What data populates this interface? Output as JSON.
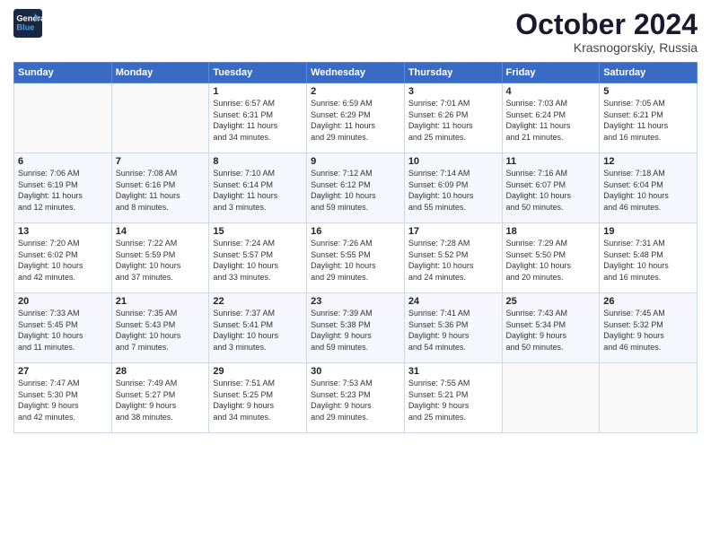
{
  "header": {
    "logo_line1": "General",
    "logo_line2": "Blue",
    "month": "October 2024",
    "location": "Krasnogorskiy, Russia"
  },
  "days_of_week": [
    "Sunday",
    "Monday",
    "Tuesday",
    "Wednesday",
    "Thursday",
    "Friday",
    "Saturday"
  ],
  "weeks": [
    [
      {
        "day": "",
        "info": ""
      },
      {
        "day": "",
        "info": ""
      },
      {
        "day": "1",
        "info": "Sunrise: 6:57 AM\nSunset: 6:31 PM\nDaylight: 11 hours\nand 34 minutes."
      },
      {
        "day": "2",
        "info": "Sunrise: 6:59 AM\nSunset: 6:29 PM\nDaylight: 11 hours\nand 29 minutes."
      },
      {
        "day": "3",
        "info": "Sunrise: 7:01 AM\nSunset: 6:26 PM\nDaylight: 11 hours\nand 25 minutes."
      },
      {
        "day": "4",
        "info": "Sunrise: 7:03 AM\nSunset: 6:24 PM\nDaylight: 11 hours\nand 21 minutes."
      },
      {
        "day": "5",
        "info": "Sunrise: 7:05 AM\nSunset: 6:21 PM\nDaylight: 11 hours\nand 16 minutes."
      }
    ],
    [
      {
        "day": "6",
        "info": "Sunrise: 7:06 AM\nSunset: 6:19 PM\nDaylight: 11 hours\nand 12 minutes."
      },
      {
        "day": "7",
        "info": "Sunrise: 7:08 AM\nSunset: 6:16 PM\nDaylight: 11 hours\nand 8 minutes."
      },
      {
        "day": "8",
        "info": "Sunrise: 7:10 AM\nSunset: 6:14 PM\nDaylight: 11 hours\nand 3 minutes."
      },
      {
        "day": "9",
        "info": "Sunrise: 7:12 AM\nSunset: 6:12 PM\nDaylight: 10 hours\nand 59 minutes."
      },
      {
        "day": "10",
        "info": "Sunrise: 7:14 AM\nSunset: 6:09 PM\nDaylight: 10 hours\nand 55 minutes."
      },
      {
        "day": "11",
        "info": "Sunrise: 7:16 AM\nSunset: 6:07 PM\nDaylight: 10 hours\nand 50 minutes."
      },
      {
        "day": "12",
        "info": "Sunrise: 7:18 AM\nSunset: 6:04 PM\nDaylight: 10 hours\nand 46 minutes."
      }
    ],
    [
      {
        "day": "13",
        "info": "Sunrise: 7:20 AM\nSunset: 6:02 PM\nDaylight: 10 hours\nand 42 minutes."
      },
      {
        "day": "14",
        "info": "Sunrise: 7:22 AM\nSunset: 5:59 PM\nDaylight: 10 hours\nand 37 minutes."
      },
      {
        "day": "15",
        "info": "Sunrise: 7:24 AM\nSunset: 5:57 PM\nDaylight: 10 hours\nand 33 minutes."
      },
      {
        "day": "16",
        "info": "Sunrise: 7:26 AM\nSunset: 5:55 PM\nDaylight: 10 hours\nand 29 minutes."
      },
      {
        "day": "17",
        "info": "Sunrise: 7:28 AM\nSunset: 5:52 PM\nDaylight: 10 hours\nand 24 minutes."
      },
      {
        "day": "18",
        "info": "Sunrise: 7:29 AM\nSunset: 5:50 PM\nDaylight: 10 hours\nand 20 minutes."
      },
      {
        "day": "19",
        "info": "Sunrise: 7:31 AM\nSunset: 5:48 PM\nDaylight: 10 hours\nand 16 minutes."
      }
    ],
    [
      {
        "day": "20",
        "info": "Sunrise: 7:33 AM\nSunset: 5:45 PM\nDaylight: 10 hours\nand 11 minutes."
      },
      {
        "day": "21",
        "info": "Sunrise: 7:35 AM\nSunset: 5:43 PM\nDaylight: 10 hours\nand 7 minutes."
      },
      {
        "day": "22",
        "info": "Sunrise: 7:37 AM\nSunset: 5:41 PM\nDaylight: 10 hours\nand 3 minutes."
      },
      {
        "day": "23",
        "info": "Sunrise: 7:39 AM\nSunset: 5:38 PM\nDaylight: 9 hours\nand 59 minutes."
      },
      {
        "day": "24",
        "info": "Sunrise: 7:41 AM\nSunset: 5:36 PM\nDaylight: 9 hours\nand 54 minutes."
      },
      {
        "day": "25",
        "info": "Sunrise: 7:43 AM\nSunset: 5:34 PM\nDaylight: 9 hours\nand 50 minutes."
      },
      {
        "day": "26",
        "info": "Sunrise: 7:45 AM\nSunset: 5:32 PM\nDaylight: 9 hours\nand 46 minutes."
      }
    ],
    [
      {
        "day": "27",
        "info": "Sunrise: 7:47 AM\nSunset: 5:30 PM\nDaylight: 9 hours\nand 42 minutes."
      },
      {
        "day": "28",
        "info": "Sunrise: 7:49 AM\nSunset: 5:27 PM\nDaylight: 9 hours\nand 38 minutes."
      },
      {
        "day": "29",
        "info": "Sunrise: 7:51 AM\nSunset: 5:25 PM\nDaylight: 9 hours\nand 34 minutes."
      },
      {
        "day": "30",
        "info": "Sunrise: 7:53 AM\nSunset: 5:23 PM\nDaylight: 9 hours\nand 29 minutes."
      },
      {
        "day": "31",
        "info": "Sunrise: 7:55 AM\nSunset: 5:21 PM\nDaylight: 9 hours\nand 25 minutes."
      },
      {
        "day": "",
        "info": ""
      },
      {
        "day": "",
        "info": ""
      }
    ]
  ]
}
